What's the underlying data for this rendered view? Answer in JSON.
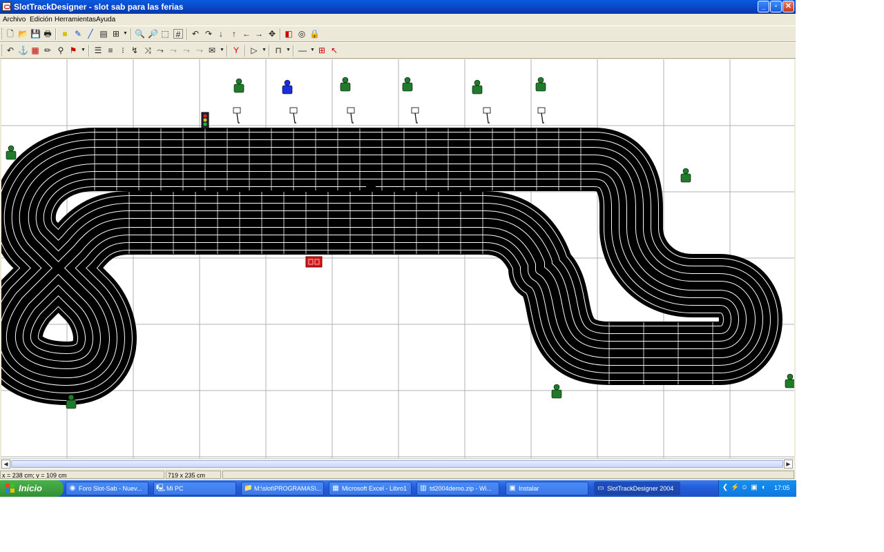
{
  "window": {
    "title": "SlotTrackDesigner - slot sab para las ferias"
  },
  "menu": [
    "Archivo",
    "Edición",
    "Herramientas",
    "Ayuda"
  ],
  "status": {
    "coords": "x = 238 cm; y = 109 cm",
    "size": "719 x 235 cm"
  },
  "taskbar": {
    "start_label": "Inicio",
    "tasks": [
      {
        "label": "Foro Slot-Sab - Nuev...",
        "icon": "browser-icon"
      },
      {
        "label": "Mi PC",
        "icon": "computer-icon"
      },
      {
        "label": "M:\\slot\\PROGRAMAS\\...",
        "icon": "folder-icon"
      },
      {
        "label": "Microsoft Excel - Libro1",
        "icon": "excel-icon"
      },
      {
        "label": "td2004demo.zip - Wi...",
        "icon": "winzip-icon"
      },
      {
        "label": "Instalar",
        "icon": "setup-icon"
      },
      {
        "label": "SlotTrackDesigner 2004",
        "icon": "app-icon"
      }
    ],
    "clock": "17:05"
  },
  "track_colors": {
    "asphalt": "#000000",
    "lines": "#ffffff",
    "grid": "#b0b0b0",
    "marshal": "#1f7a2a",
    "marshal_selected": "#1a2fd6",
    "timer": "#d01818"
  }
}
